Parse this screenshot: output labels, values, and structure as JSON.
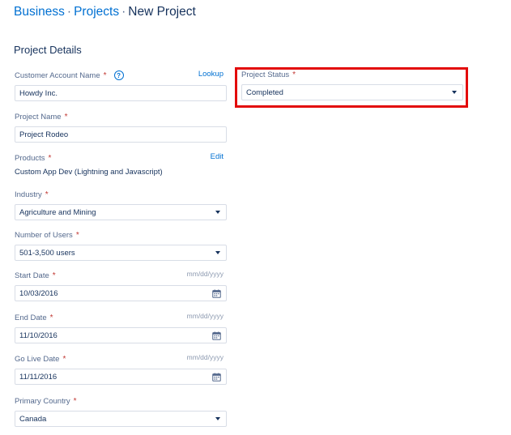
{
  "breadcrumb": {
    "items": [
      "Business",
      "Projects",
      "New Project"
    ],
    "separator": "·"
  },
  "section_title": "Project Details",
  "fields": {
    "customer_account": {
      "label": "Customer Account Name",
      "required": "*",
      "help": "?",
      "action": "Lookup",
      "value": "Howdy Inc."
    },
    "project_name": {
      "label": "Project Name",
      "required": "*",
      "value": "Project Rodeo"
    },
    "products": {
      "label": "Products",
      "required": "*",
      "action": "Edit",
      "value": "Custom App Dev (Lightning and Javascript)"
    },
    "industry": {
      "label": "Industry",
      "required": "*",
      "value": "Agriculture and Mining"
    },
    "number_of_users": {
      "label": "Number of Users",
      "required": "*",
      "value": "501-3,500 users"
    },
    "start_date": {
      "label": "Start Date",
      "required": "*",
      "format": "mm/dd/yyyy",
      "value": "10/03/2016"
    },
    "end_date": {
      "label": "End Date",
      "required": "*",
      "format": "mm/dd/yyyy",
      "value": "11/10/2016"
    },
    "go_live_date": {
      "label": "Go Live Date",
      "required": "*",
      "format": "mm/dd/yyyy",
      "value": "11/11/2016"
    },
    "primary_country": {
      "label": "Primary Country",
      "required": "*",
      "value": "Canada"
    },
    "project_status": {
      "label": "Project Status",
      "required": "*",
      "value": "Completed"
    }
  },
  "colors": {
    "link": "#0070d2",
    "text": "#16325c",
    "label": "#54698d",
    "required": "#c23934",
    "border": "#d8dde6",
    "highlight": "#e30b0b"
  },
  "icons": {
    "help": "help-icon",
    "calendar": "calendar-icon",
    "dropdown": "chevron-down-icon"
  }
}
